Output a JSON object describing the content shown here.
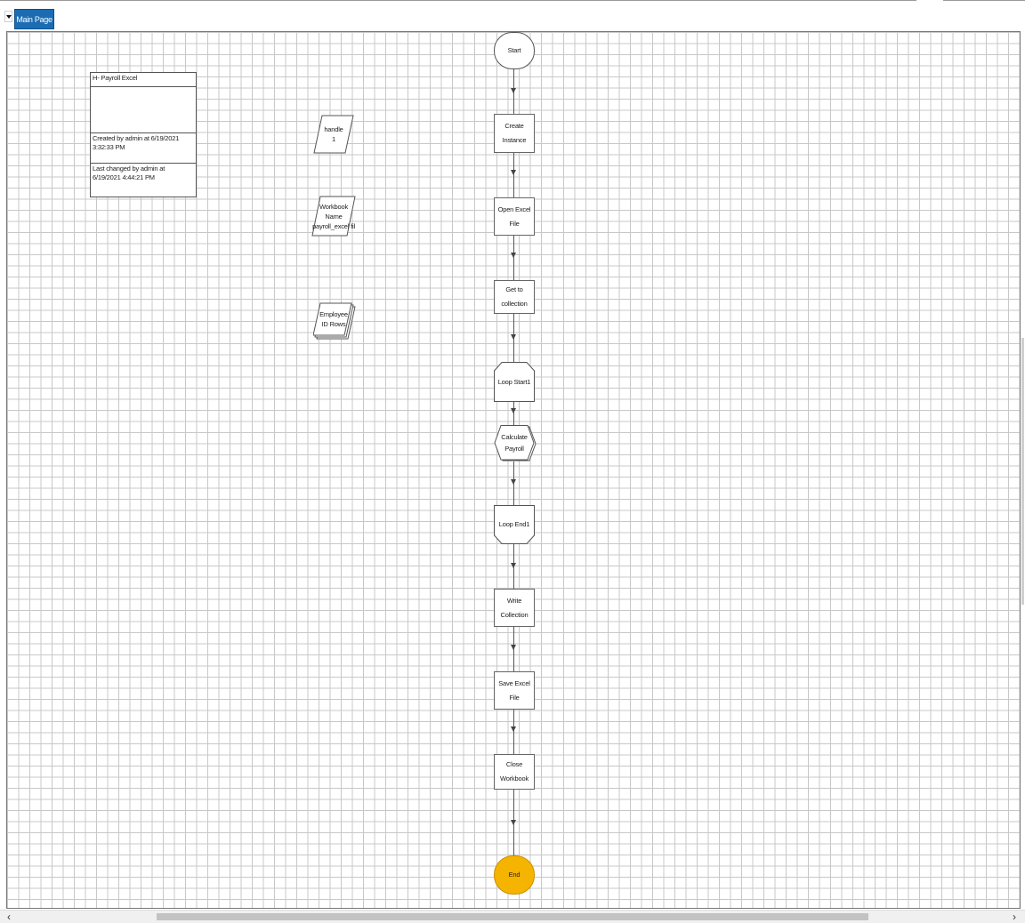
{
  "tabs": [
    {
      "label": "Main Page",
      "active": true
    }
  ],
  "info_box": {
    "title": "H- Payroll Excel",
    "description": "",
    "created": "Created by admin at 6/19/2021 3:32:33 PM",
    "changed": "Last changed by admin at 6/19/2021 4:44:21 PM"
  },
  "data_items": [
    {
      "text": "handle\n1"
    },
    {
      "text": "Workbook\nName\npayroll_excel fil"
    },
    {
      "text": "Employee\nID Rows"
    }
  ],
  "flow": [
    {
      "type": "terminator",
      "label": "Start"
    },
    {
      "type": "action",
      "label": "Create Instance"
    },
    {
      "type": "action",
      "label": "Open Excel File"
    },
    {
      "type": "action",
      "label": "Get to\ncollection"
    },
    {
      "type": "loop-start",
      "label": "Loop Start1"
    },
    {
      "type": "calc",
      "label": "Calculate\nPayroll"
    },
    {
      "type": "loop-end",
      "label": "Loop End1"
    },
    {
      "type": "action",
      "label": "Write\nCollection"
    },
    {
      "type": "action",
      "label": "Save Excel File"
    },
    {
      "type": "action",
      "label": "Close\nWorkbook"
    },
    {
      "type": "end",
      "label": "End"
    }
  ],
  "colors": {
    "tab_active": "#1c6cb4",
    "end_fill": "#f5b400",
    "grid_line": "#c8c8c8"
  },
  "icons": {
    "tab_dropdown": "dropdown-arrow-icon"
  }
}
